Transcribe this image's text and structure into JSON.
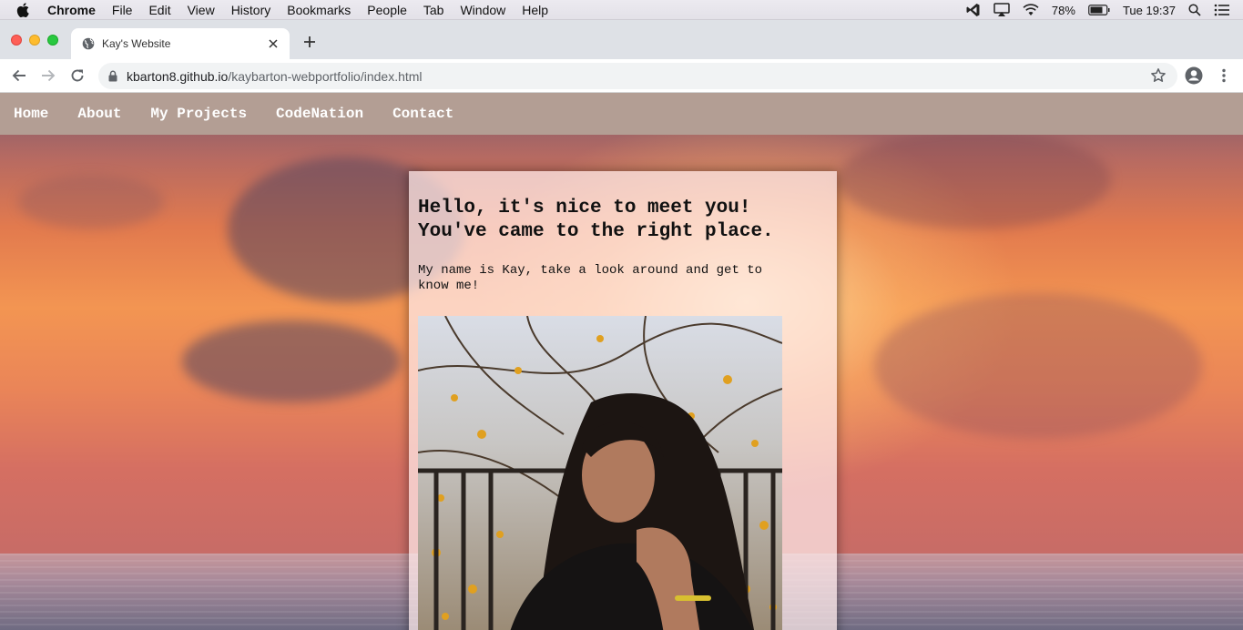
{
  "menubar": {
    "app": "Chrome",
    "items": [
      "File",
      "Edit",
      "View",
      "History",
      "Bookmarks",
      "People",
      "Tab",
      "Window",
      "Help"
    ],
    "battery": "78%",
    "clock": "Tue 19:37"
  },
  "browser": {
    "tab_title": "Kay's Website",
    "url_host": "kbarton8.github.io",
    "url_path": "/kaybarton-webportfolio/index.html"
  },
  "site": {
    "nav": [
      "Home",
      "About",
      "My Projects",
      "CodeNation",
      "Contact"
    ],
    "heading": "Hello, it's nice to meet you! You've came to the right place.",
    "intro": "My name is Kay, take a look around and get to know me!"
  }
}
